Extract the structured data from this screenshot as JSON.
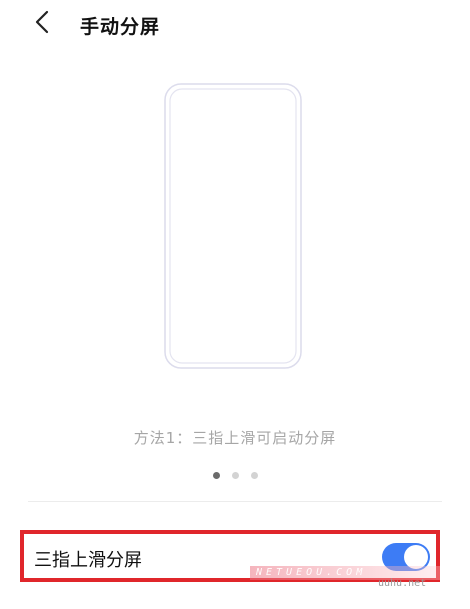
{
  "header": {
    "back_icon": "chevron-left-icon",
    "title": "手动分屏"
  },
  "illustration": {
    "carousel_index": 1,
    "carousel_total": 3
  },
  "caption": "方法1：三指上滑可启动分屏",
  "setting": {
    "label": "三指上滑分屏",
    "toggle_state": "on"
  },
  "watermark": {
    "text": "NETUEOU.COM",
    "small_text": "uuhu.net"
  },
  "colors": {
    "toggle_on": "#3d7cf5",
    "highlight_border": "#e0262b",
    "caption_text": "#a6a6a6"
  }
}
